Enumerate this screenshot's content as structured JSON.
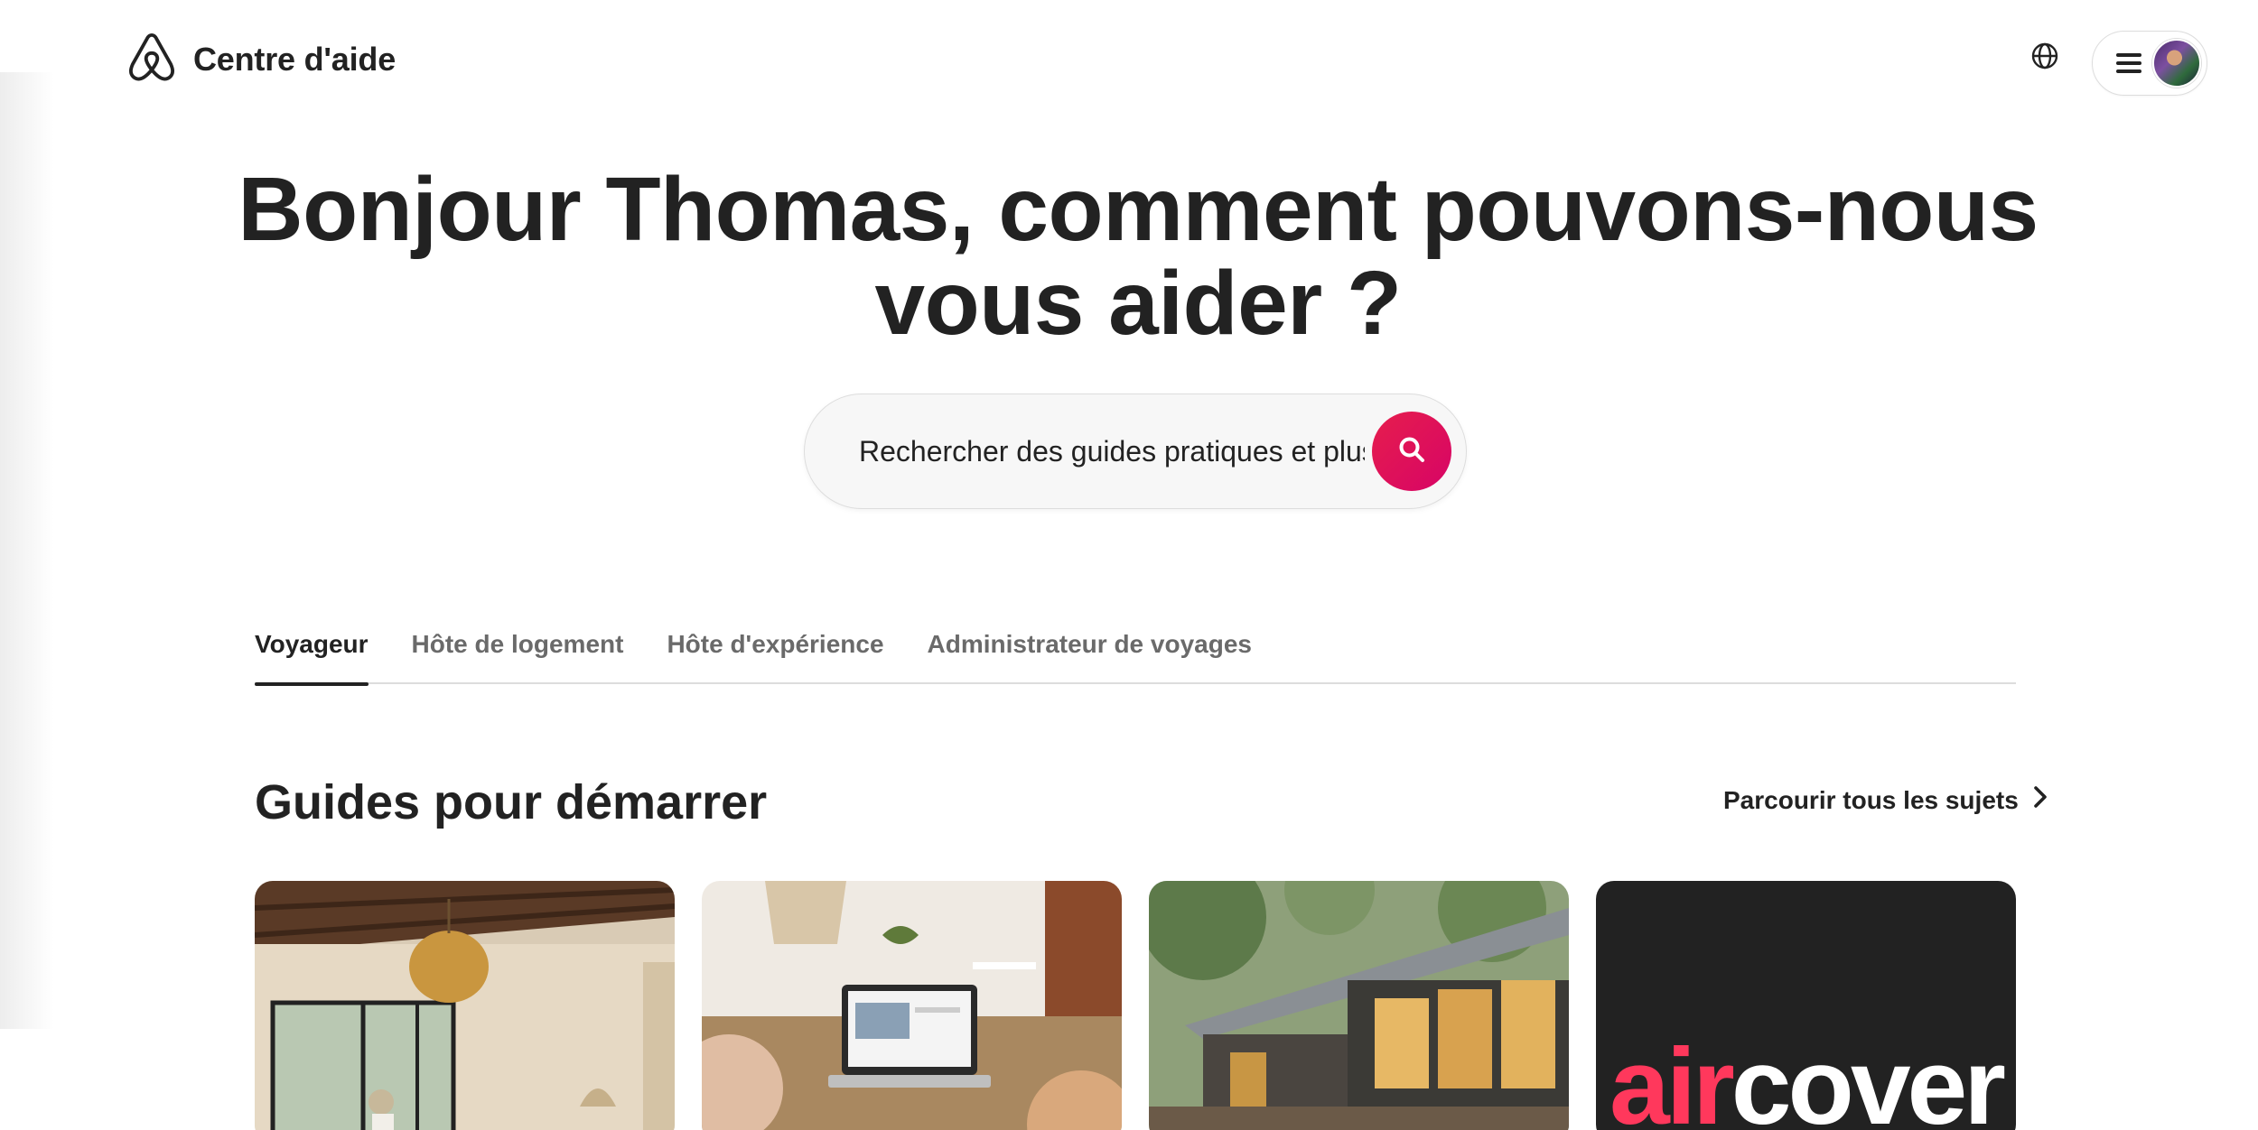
{
  "header": {
    "brand_title": "Centre d'aide",
    "logo_icon": "airbnb-logo-icon",
    "globe_icon": "globe-icon",
    "menu_icon": "hamburger-menu-icon",
    "avatar_icon": "user-avatar"
  },
  "hero": {
    "title": "Bonjour Thomas, comment pouvons-nous vous aider ?"
  },
  "search": {
    "placeholder": "Rechercher des guides pratiques et plus",
    "button_icon": "search-icon",
    "accent_color": "#e61e4d"
  },
  "tabs": [
    {
      "label": "Voyageur",
      "active": true
    },
    {
      "label": "Hôte de logement",
      "active": false
    },
    {
      "label": "Hôte d'expérience",
      "active": false
    },
    {
      "label": "Administrateur de voyages",
      "active": false
    }
  ],
  "section": {
    "title": "Guides pour démarrer",
    "browse_label": "Parcourir tous les sujets",
    "browse_icon": "chevron-right-icon"
  },
  "cards": [
    {
      "image": "living-room-photo"
    },
    {
      "image": "laptop-on-table-photo"
    },
    {
      "image": "cabin-exterior-photo"
    },
    {
      "logo_text_1": "air",
      "logo_text_2": "cover",
      "logo_color": "#ff385c"
    }
  ]
}
